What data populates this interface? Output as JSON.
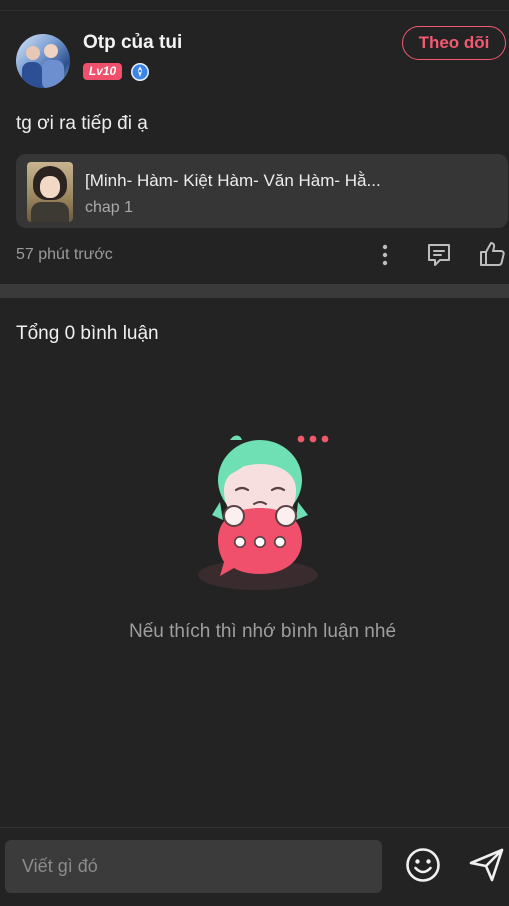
{
  "post": {
    "username": "Otp của tui",
    "level": "Lv10",
    "follow_label": "Theo dõi",
    "comment": "tg ơi ra tiếp đi ạ",
    "story": {
      "title": "[Minh- Hàm- Kiệt Hàm- Văn Hàm- Hằ...",
      "chapter": "chap 1"
    },
    "timestamp": "57 phút trước"
  },
  "comments": {
    "heading": "Tổng 0 bình luận",
    "empty_message": "Nếu thích thì nhớ bình luận nhé"
  },
  "composer": {
    "placeholder": "Viết gì đó"
  },
  "icons": [
    "verified-icon",
    "more-vertical-icon",
    "reply-icon",
    "like-icon",
    "emoji-icon",
    "send-icon"
  ],
  "colors": {
    "background": "#232323",
    "accent": "#f15a70",
    "card": "#363636",
    "mascot_hair": "#6ee0b3",
    "bubble": "#f0506c"
  }
}
